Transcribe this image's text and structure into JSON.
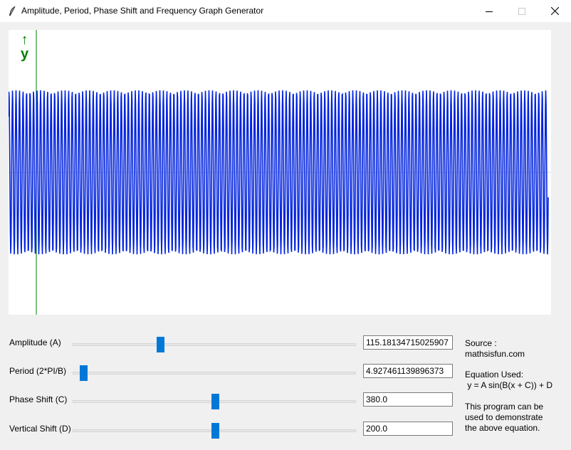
{
  "window": {
    "title": "Amplitude, Period, Phase Shift and Frequency Graph Generator",
    "app_icon": "feather-icon",
    "minimize_icon": "minimize-icon",
    "maximize_icon": "maximize-icon",
    "close_icon": "close-icon"
  },
  "graph": {
    "axis_arrow": "↑",
    "axis_label": "y",
    "axis_color": "#008000",
    "curve_color": "#0022dd",
    "equation": "y = A sin(B(x + C)) + D"
  },
  "controls": [
    {
      "label": "Amplitude (A)",
      "value": "115.18134715025907",
      "slider_fraction": 0.3
    },
    {
      "label": "Period (2*PI/B)",
      "value": "4.927461139896373",
      "slider_fraction": 0.02
    },
    {
      "label": "Phase Shift (C)",
      "value": "380.0",
      "slider_fraction": 0.5
    },
    {
      "label": "Vertical Shift (D)",
      "value": "200.0",
      "slider_fraction": 0.5
    }
  ],
  "info": {
    "source": "Source :\nmathsisfun.com",
    "equation_text": "Equation Used:\n y = A sin(B(x + C)) + D",
    "description": "This program can be\nused to demonstrate\nthe above equation."
  },
  "colors": {
    "slider_thumb": "#0078d7",
    "window_bg": "#f0f0f0"
  }
}
